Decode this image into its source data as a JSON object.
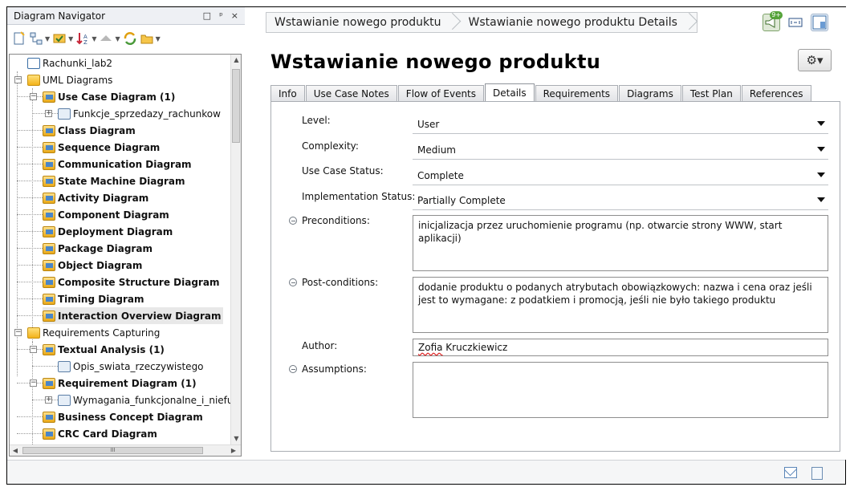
{
  "navigator": {
    "title": "Diagram Navigator",
    "controls": [
      "□",
      "ᵖ",
      "×"
    ],
    "toolbar": [
      "new-diagram-icon",
      "hierarchy-icon",
      "filter-icon",
      "sort-icon",
      "navigate-up-icon",
      "refresh-icon",
      "open-folder-icon"
    ],
    "tree": [
      {
        "label": "Rachunki_lab2",
        "bold": false,
        "icon": "project-icon",
        "level": 0
      },
      {
        "label": "UML Diagrams",
        "bold": false,
        "icon": "folder-icon",
        "level": 0,
        "expander": "−"
      },
      {
        "label": "Use Case Diagram (1)",
        "bold": true,
        "icon": "use-case-diagram-icon",
        "level": 1,
        "expander": "−"
      },
      {
        "label": "Funkcje_sprzedazy_rachunkow",
        "bold": false,
        "icon": "diagram-file-icon",
        "level": 2,
        "expander": "+"
      },
      {
        "label": "Class Diagram",
        "bold": true,
        "icon": "class-diagram-icon",
        "level": 1
      },
      {
        "label": "Sequence Diagram",
        "bold": true,
        "icon": "sequence-diagram-icon",
        "level": 1
      },
      {
        "label": "Communication Diagram",
        "bold": true,
        "icon": "communication-diagram-icon",
        "level": 1
      },
      {
        "label": "State Machine Diagram",
        "bold": true,
        "icon": "state-machine-diagram-icon",
        "level": 1
      },
      {
        "label": "Activity Diagram",
        "bold": true,
        "icon": "activity-diagram-icon",
        "level": 1
      },
      {
        "label": "Component Diagram",
        "bold": true,
        "icon": "component-diagram-icon",
        "level": 1
      },
      {
        "label": "Deployment Diagram",
        "bold": true,
        "icon": "deployment-diagram-icon",
        "level": 1
      },
      {
        "label": "Package Diagram",
        "bold": true,
        "icon": "package-diagram-icon",
        "level": 1
      },
      {
        "label": "Object Diagram",
        "bold": true,
        "icon": "object-diagram-icon",
        "level": 1
      },
      {
        "label": "Composite Structure Diagram",
        "bold": true,
        "icon": "composite-structure-diagram-icon",
        "level": 1
      },
      {
        "label": "Timing Diagram",
        "bold": true,
        "icon": "timing-diagram-icon",
        "level": 1
      },
      {
        "label": "Interaction Overview Diagram",
        "bold": true,
        "icon": "interaction-overview-diagram-icon",
        "level": 1,
        "selected": true
      },
      {
        "label": "Requirements Capturing",
        "bold": false,
        "icon": "folder-icon",
        "level": 0,
        "expander": "−"
      },
      {
        "label": "Textual Analysis (1)",
        "bold": true,
        "icon": "textual-analysis-icon",
        "level": 1,
        "expander": "−"
      },
      {
        "label": "Opis_swiata_rzeczywistego",
        "bold": false,
        "icon": "diagram-file-icon",
        "level": 2
      },
      {
        "label": "Requirement Diagram (1)",
        "bold": true,
        "icon": "requirement-diagram-icon",
        "level": 1,
        "expander": "−"
      },
      {
        "label": "Wymagania_funkcjonalne_i_niefu",
        "bold": false,
        "icon": "diagram-file-icon",
        "level": 2,
        "expander": "+"
      },
      {
        "label": "Business Concept Diagram",
        "bold": true,
        "icon": "business-concept-diagram-icon",
        "level": 1
      },
      {
        "label": "CRC Card Diagram",
        "bold": true,
        "icon": "crc-card-diagram-icon",
        "level": 1
      }
    ],
    "hscroll_grip": "III"
  },
  "breadcrumb": [
    "Wstawianie nowego produktu",
    "Wstawianie nowego produktu Details"
  ],
  "top_icons": {
    "badge": "9+"
  },
  "page_title": "Wstawianie nowego produktu",
  "gear_menu": "⚙▾",
  "tabs": [
    {
      "label": "Info",
      "active": false
    },
    {
      "label": "Use Case Notes",
      "active": false
    },
    {
      "label": "Flow of Events",
      "active": false
    },
    {
      "label": "Details",
      "active": true
    },
    {
      "label": "Requirements",
      "active": false
    },
    {
      "label": "Diagrams",
      "active": false
    },
    {
      "label": "Test Plan",
      "active": false
    },
    {
      "label": "References",
      "active": false
    }
  ],
  "details": {
    "level": {
      "label": "Level:",
      "value": "User"
    },
    "complexity": {
      "label": "Complexity:",
      "value": "Medium"
    },
    "use_case_status": {
      "label": "Use Case Status:",
      "value": "Complete"
    },
    "implementation_status": {
      "label": "Implementation Status:",
      "value": "Partially Complete"
    },
    "preconditions": {
      "label": "Preconditions:",
      "value": "inicjalizacja przez uruchomienie programu (np. otwarcie strony WWW, start aplikacji)"
    },
    "post_conditions": {
      "label": "Post-conditions:",
      "value": "dodanie produktu o podanych atrybutach obowiązkowych: nazwa i cena oraz jeśli jest to wymagane: z podatkiem i promocją, jeśli nie było takiego produktu"
    },
    "author": {
      "label": "Author:",
      "first": "Zofia",
      "rest": " Kruczkiewicz"
    },
    "assumptions": {
      "label": "Assumptions:",
      "value": ""
    }
  },
  "colors": {
    "accent": "#4a86c8",
    "folder": "#f3b21a",
    "selected_row": "#e8e8e8"
  }
}
